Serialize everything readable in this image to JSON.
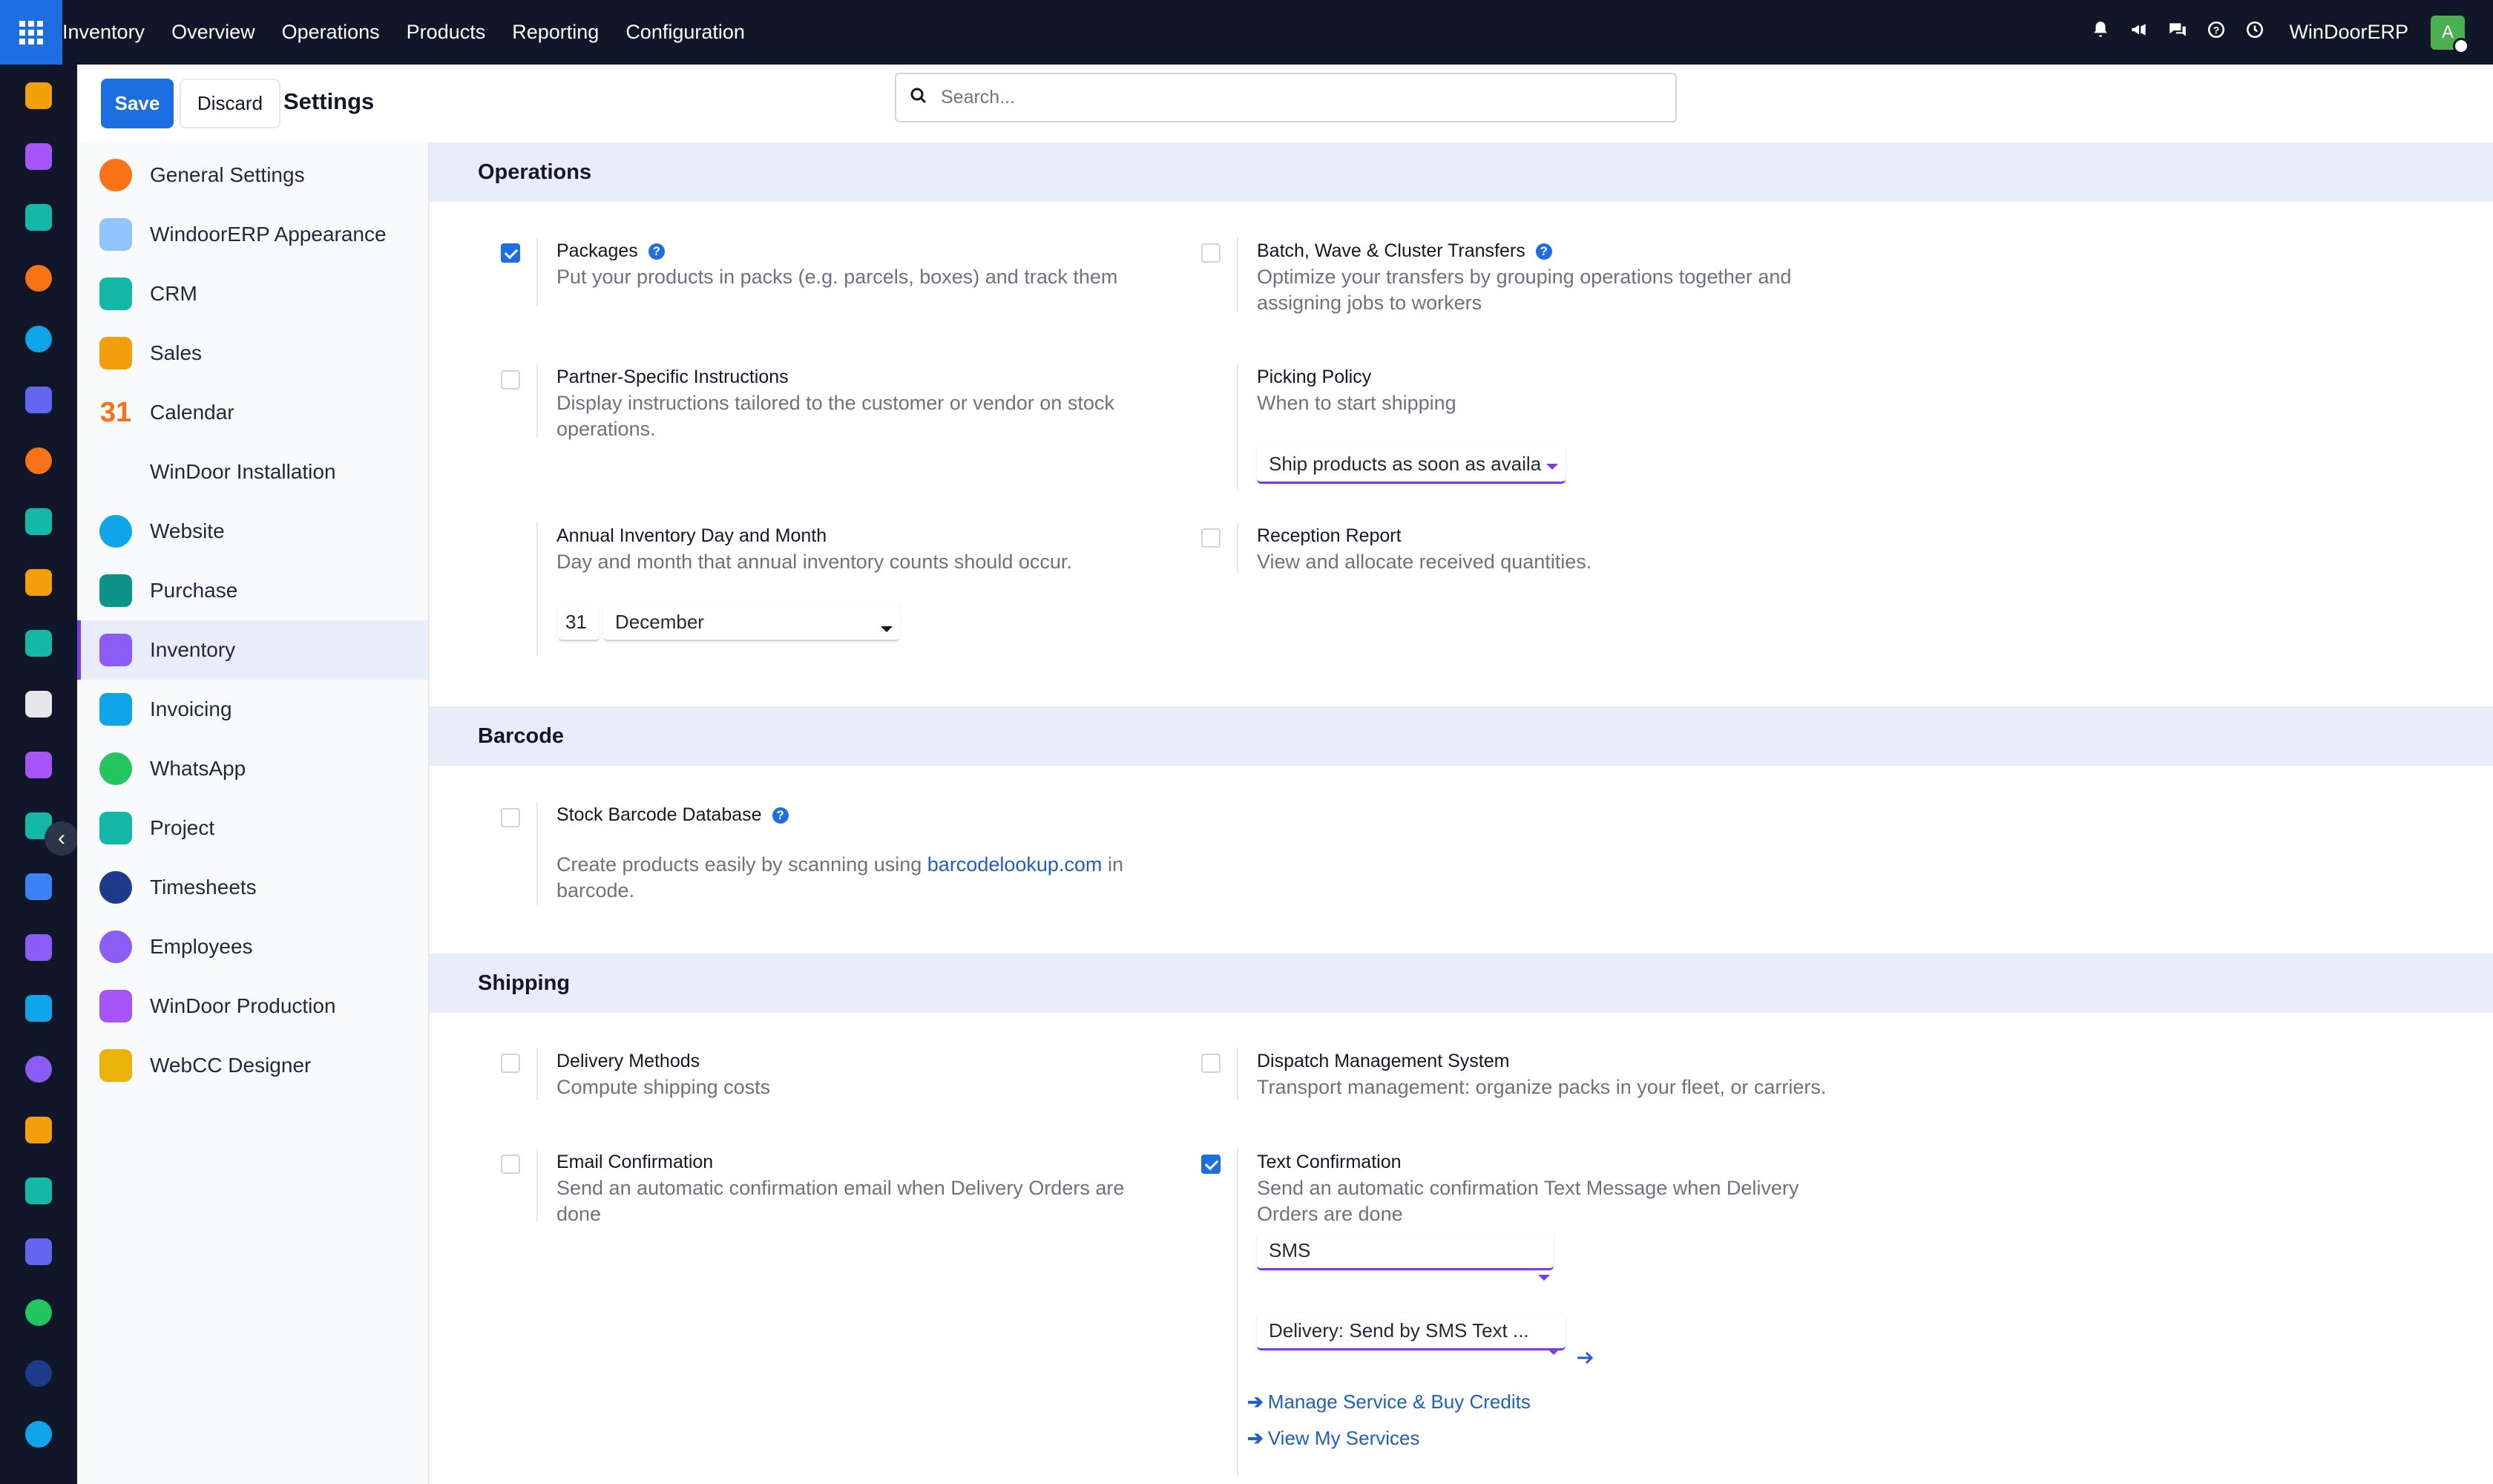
{
  "topbar": {
    "app_name": "Inventory",
    "menu": [
      "Overview",
      "Operations",
      "Products",
      "Reporting",
      "Configuration"
    ],
    "company": "WinDoorERP",
    "avatar_initial": "A"
  },
  "control_panel": {
    "save_label": "Save",
    "discard_label": "Discard",
    "title": "Settings",
    "search_placeholder": "Search..."
  },
  "sidebar": {
    "items": [
      {
        "label": "General Settings",
        "icon": "general-settings-icon",
        "color": "#f97316"
      },
      {
        "label": "WindoorERP Appearance",
        "icon": "appearance-icon",
        "color": "#3b82f6"
      },
      {
        "label": "CRM",
        "icon": "crm-icon",
        "color": "#14b8a6"
      },
      {
        "label": "Sales",
        "icon": "sales-icon",
        "color": "#f59e0b"
      },
      {
        "label": "Calendar",
        "icon": "calendar-icon",
        "color": "#f97316"
      },
      {
        "label": "WinDoor Installation",
        "icon": "",
        "color": ""
      },
      {
        "label": "Website",
        "icon": "website-icon",
        "color": "#0ea5e9"
      },
      {
        "label": "Purchase",
        "icon": "purchase-icon",
        "color": "#0d9488"
      },
      {
        "label": "Inventory",
        "icon": "inventory-icon",
        "color": "#8b5cf6"
      },
      {
        "label": "Invoicing",
        "icon": "invoicing-icon",
        "color": "#0ea5e9"
      },
      {
        "label": "WhatsApp",
        "icon": "whatsapp-icon",
        "color": "#22c55e"
      },
      {
        "label": "Project",
        "icon": "project-icon",
        "color": "#14b8a6"
      },
      {
        "label": "Timesheets",
        "icon": "timesheets-icon",
        "color": "#1e3a8a"
      },
      {
        "label": "Employees",
        "icon": "employees-icon",
        "color": "#8b5cf6"
      },
      {
        "label": "WinDoor Production",
        "icon": "production-icon",
        "color": "#a855f7"
      },
      {
        "label": "WebCC Designer",
        "icon": "webcc-designer-icon",
        "color": "#eab308"
      }
    ],
    "active": "Inventory"
  },
  "sections": {
    "operations": {
      "title": "Operations",
      "packages": {
        "title": "Packages",
        "desc": "Put your products in packs (e.g. parcels, boxes) and track them",
        "checked": true
      },
      "batch": {
        "title": "Batch, Wave & Cluster Transfers",
        "desc": "Optimize your transfers by grouping operations together and assigning jobs to workers",
        "checked": false
      },
      "partner": {
        "title": "Partner-Specific Instructions",
        "desc": "Display instructions tailored to the customer or vendor on stock operations.",
        "checked": false
      },
      "picking": {
        "title": "Picking Policy",
        "desc": "When to start shipping",
        "value": "Ship products as soon as availa"
      },
      "annual": {
        "title": "Annual Inventory Day and Month",
        "desc": "Day and month that annual inventory counts should occur.",
        "day": "31",
        "month": "December"
      },
      "reception": {
        "title": "Reception Report",
        "desc": "View and allocate received quantities.",
        "checked": false
      }
    },
    "barcode": {
      "title": "Barcode",
      "stock_db": {
        "title": "Stock Barcode Database",
        "desc_before": "Create products easily by scanning using ",
        "link": "barcodelookup.com",
        "desc_after": " in barcode.",
        "checked": false
      }
    },
    "shipping": {
      "title": "Shipping",
      "delivery_methods": {
        "title": "Delivery Methods",
        "desc": "Compute shipping costs",
        "checked": false
      },
      "dispatch": {
        "title": "Dispatch Management System",
        "desc": "Transport management: organize packs in your fleet, or carriers.",
        "checked": false
      },
      "email_conf": {
        "title": "Email Confirmation",
        "desc": "Send an automatic confirmation email when Delivery Orders are done",
        "checked": false
      },
      "text_conf": {
        "title": "Text Confirmation",
        "desc": "Send an automatic confirmation Text Message when Delivery Orders are done",
        "checked": true,
        "mode": "SMS",
        "template": "Delivery: Send by SMS Text ...",
        "link1": "Manage Service & Buy Credits",
        "link2": "View My Services"
      }
    }
  },
  "colors": {
    "brand": "#1d6ee0",
    "topbar": "#0f1729",
    "accent": "#7c3aed",
    "section_bg": "#e8eef9"
  }
}
